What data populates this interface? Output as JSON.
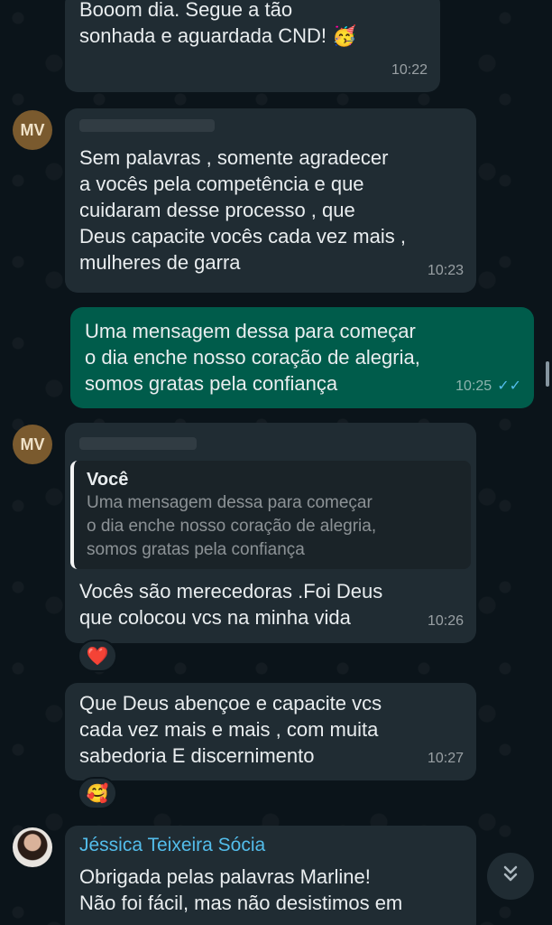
{
  "messages": [
    {
      "text": "Booom dia. Segue a tão\nsonhada e aguardada CND! 🥳",
      "time": "10:22"
    },
    {
      "avatar": "MV",
      "text": "Sem palavras , somente agradecer\na vocês pela competência e que\ncuidaram desse processo , que\nDeus capacite vocês cada vez mais ,\nmulheres de garra",
      "time": "10:23"
    },
    {
      "text": "Uma mensagem dessa para começar\no dia enche nosso coração de alegria,\nsomos gratas pela confiança",
      "time": "10:25",
      "ticks": "✓✓"
    },
    {
      "avatar": "MV",
      "quote_author": "Você",
      "quote_text": "Uma mensagem dessa para começar\no dia enche nosso coração de alegria,\nsomos gratas pela confiança",
      "text": "Vocês são merecedoras .Foi Deus\nque colocou vcs na minha vida",
      "time": "10:26",
      "reaction": "❤️"
    },
    {
      "text": "Que Deus abençoe e capacite vcs\ncada vez mais e mais , com muita\nsabedoria E discernimento",
      "time": "10:27",
      "reaction": "🥰"
    },
    {
      "sender": "Jéssica Teixeira Sócia",
      "text": "Obrigada pelas palavras Marline!\nNão foi fácil, mas não desistimos em"
    }
  ],
  "scroll_down_icon": "double-chevron-down-icon",
  "colors": {
    "background": "#0b141a",
    "incoming_bubble": "#202c33",
    "outgoing_bubble": "#005c4b",
    "sender_name": "#53bdeb",
    "read_ticks": "#53bdeb"
  }
}
